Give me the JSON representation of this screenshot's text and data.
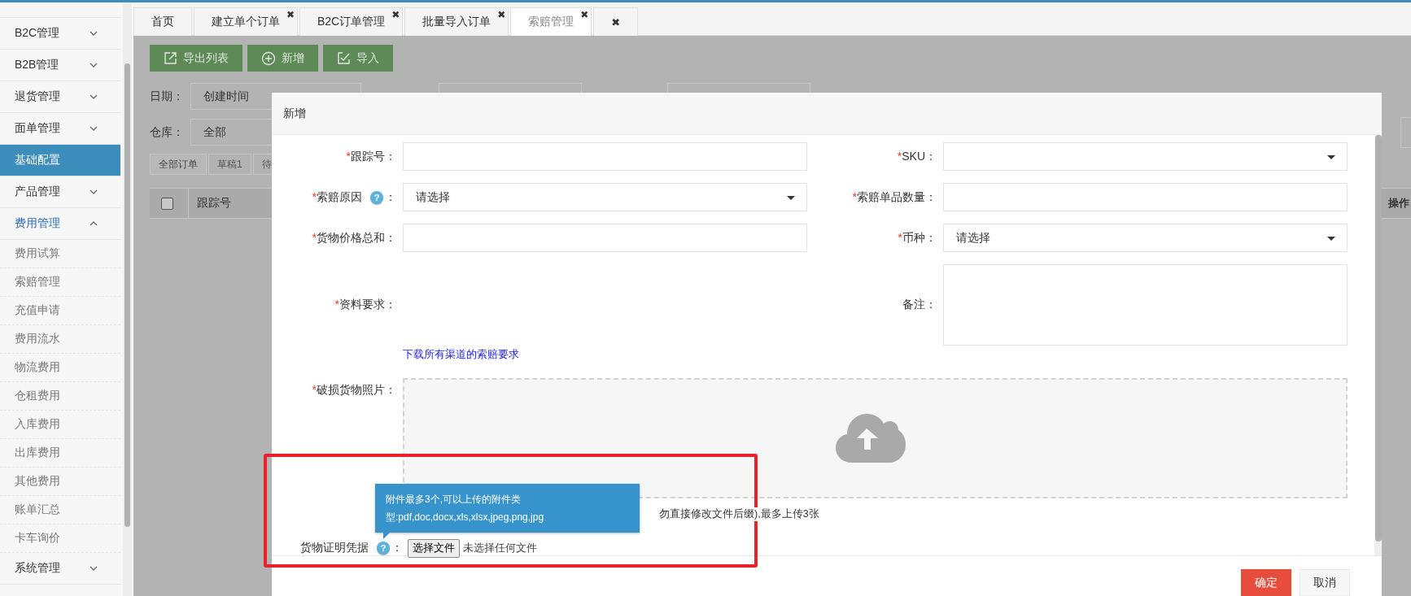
{
  "sidebar": {
    "items": [
      {
        "label": "B2C管理",
        "selected": false,
        "expanded": false
      },
      {
        "label": "B2B管理",
        "selected": false,
        "expanded": false
      },
      {
        "label": "退货管理",
        "selected": false,
        "expanded": false
      },
      {
        "label": "面单管理",
        "selected": false,
        "expanded": false
      },
      {
        "label": "基础配置",
        "selected": true,
        "expanded": false
      },
      {
        "label": "产品管理",
        "selected": false,
        "expanded": false
      },
      {
        "label": "费用管理",
        "selected": false,
        "expanded": true,
        "children": [
          {
            "label": "费用试算",
            "selected": false
          },
          {
            "label": "索赔管理",
            "selected": false
          },
          {
            "label": "充值申请",
            "selected": false
          },
          {
            "label": "费用流水",
            "selected": false
          },
          {
            "label": "物流费用",
            "selected": false
          },
          {
            "label": "仓租费用",
            "selected": false
          },
          {
            "label": "入库费用",
            "selected": false
          },
          {
            "label": "出库费用",
            "selected": false
          },
          {
            "label": "其他费用",
            "selected": false
          },
          {
            "label": "账单汇总",
            "selected": false
          },
          {
            "label": "卡车询价",
            "selected": false
          }
        ]
      },
      {
        "label": "系统管理",
        "selected": false,
        "expanded": false
      }
    ]
  },
  "tabs": [
    {
      "label": "首页",
      "selected": false
    },
    {
      "label": "建立单个订单",
      "selected": false,
      "close": "✖"
    },
    {
      "label": "B2C订单管理",
      "selected": false,
      "close": "✖"
    },
    {
      "label": "批量导入订单",
      "selected": false,
      "close": "✖"
    },
    {
      "label": "索赔管理",
      "selected": true,
      "close": "✖"
    }
  ],
  "close_all": "✖",
  "toolbar": [
    {
      "label": "导出列表",
      "kind": "export"
    },
    {
      "label": "新增",
      "kind": "add"
    },
    {
      "label": "导入",
      "kind": "import"
    }
  ],
  "filters": {
    "date_label": "日期：",
    "date_value": "创建时间",
    "warehouse_label": "仓库：",
    "warehouse_value": "全部"
  },
  "status_tabs": [
    {
      "label": "全部订单",
      "selected": true
    },
    {
      "label": "草稿1",
      "selected": false
    },
    {
      "label": "待",
      "selected": false
    }
  ],
  "table": {
    "columns": [
      "跟踪号",
      "操作"
    ],
    "select_all_checked": false
  },
  "modal": {
    "title": "新增",
    "fields": [
      {
        "kind": "text",
        "mark": "*",
        "label": "跟踪号："
      },
      {
        "kind": "select",
        "mark": "*",
        "label": "SKU："
      },
      {
        "kind": "select",
        "mark": "*",
        "label": "索赔原因",
        "help": "?",
        "colon": "：",
        "value": "请选择"
      },
      {
        "kind": "text",
        "mark": "*",
        "label": "索赔单品数量："
      },
      {
        "kind": "text",
        "mark": "*",
        "label": "货物价格总和："
      },
      {
        "kind": "select",
        "mark": "*",
        "label": "币种：",
        "value": "请选择"
      },
      {
        "kind": "static",
        "mark": "*",
        "label": "资料要求："
      },
      {
        "kind": "textarea",
        "label": "备注："
      }
    ],
    "link": "下载所有渠道的索赔要求",
    "upload": {
      "mark": "*",
      "label": "破损货物照片：",
      "hint": "勿直接修改文件后缀),最多上传3张"
    },
    "file": {
      "label": "货物证明凭据",
      "help": "?",
      "colon": "：",
      "button": "选择文件",
      "status": "未选择任何文件"
    },
    "tooltip": [
      "附件最多3个,可以上传的附件类",
      "型:pdf,doc,docx,xls,xlsx,jpeg,png,jpg"
    ],
    "buttons": [
      {
        "label": "确定",
        "kind": "primary"
      },
      {
        "label": "取消",
        "kind": "default"
      }
    ]
  }
}
